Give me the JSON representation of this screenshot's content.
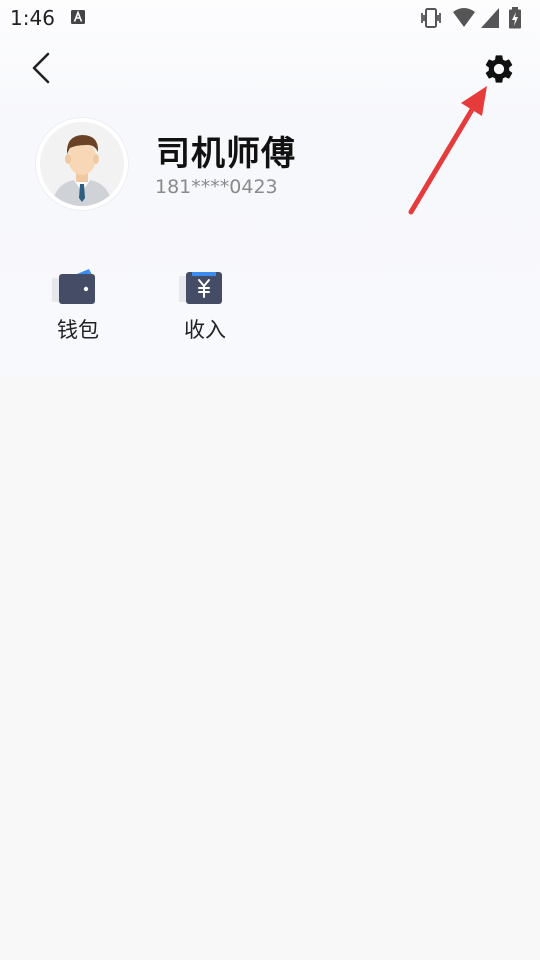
{
  "status_bar": {
    "time": "1:46",
    "icons": [
      "text-a-icon",
      "vibrate-icon",
      "wifi-icon",
      "signal-icon",
      "battery-charging-icon"
    ]
  },
  "nav": {
    "back_icon": "chevron-left-icon",
    "settings_icon": "gear-icon"
  },
  "profile": {
    "name": "司机师傅",
    "phone": "181****0423"
  },
  "actions": [
    {
      "label": "钱包",
      "icon": "wallet-icon"
    },
    {
      "label": "收入",
      "icon": "income-icon"
    }
  ],
  "colors": {
    "icon_dark": "#454d66",
    "icon_accent": "#3c8cf0",
    "annotation_arrow": "#e63b3b"
  }
}
